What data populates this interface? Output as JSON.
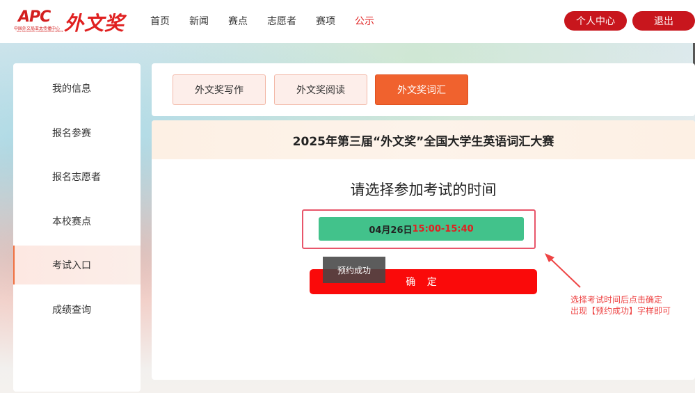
{
  "header": {
    "logo_apc_text": "APC",
    "logo_apc_sub": "中国外文局亚太传播中心",
    "logo_apc_sub_en": "ACG ASIA-PACIFIC COMMUNICATION CENTER",
    "logo_brand": "外文奖",
    "nav": [
      {
        "label": "首页"
      },
      {
        "label": "新闻"
      },
      {
        "label": "赛点"
      },
      {
        "label": "志愿者"
      },
      {
        "label": "赛项"
      },
      {
        "label": "公示"
      }
    ],
    "nav_active_index": 5,
    "user_center_label": "个人中心",
    "logout_label": "退出"
  },
  "sidebar": {
    "items": [
      {
        "label": "我的信息"
      },
      {
        "label": "报名参赛"
      },
      {
        "label": "报名志愿者"
      },
      {
        "label": "本校赛点"
      },
      {
        "label": "考试入口"
      },
      {
        "label": "成绩查询"
      }
    ],
    "active_index": 4
  },
  "tabs": {
    "items": [
      {
        "label": "外文奖写作"
      },
      {
        "label": "外文奖阅读"
      },
      {
        "label": "外文奖词汇"
      }
    ],
    "active_index": 2
  },
  "main": {
    "contest_title": "2025年第三届“外文奖”全国大学生英语词汇大赛",
    "choose_title": "请选择参加考试的时间",
    "time_option": {
      "date": "04月26日",
      "range": "15:00-15:40"
    },
    "confirm_label": "确 定",
    "toast": "预约成功"
  },
  "annotation": {
    "line1": "选择考试时间后点击确定",
    "line2": "出现【预约成功】字样即可"
  },
  "colors": {
    "brand_red": "#c8161d",
    "accent_orange": "#f0622e",
    "time_green": "#42c28b",
    "confirm_red": "#fa0a0a",
    "annotation_red": "#ee4444"
  }
}
